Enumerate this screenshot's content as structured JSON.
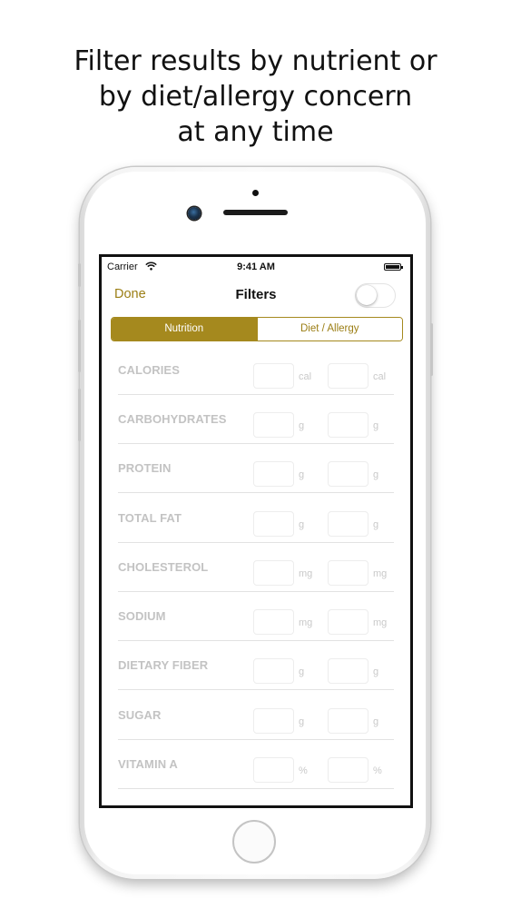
{
  "headline": {
    "line1": "Filter results by nutrient or",
    "line2": "by diet/allergy concern",
    "line3": "at any time"
  },
  "status_bar": {
    "carrier": "Carrier",
    "time": "9:41 AM"
  },
  "nav": {
    "done_label": "Done",
    "title": "Filters",
    "toggle_on": false
  },
  "segments": {
    "nutrition": "Nutrition",
    "diet_allergy": "Diet / Allergy",
    "selected": "Nutrition"
  },
  "nutrients": [
    {
      "label": "CALORIES",
      "unit": "cal"
    },
    {
      "label": "CARBOHYDRATES",
      "unit": "g"
    },
    {
      "label": "PROTEIN",
      "unit": "g"
    },
    {
      "label": "TOTAL FAT",
      "unit": "g"
    },
    {
      "label": "CHOLESTEROL",
      "unit": "mg"
    },
    {
      "label": "SODIUM",
      "unit": "mg"
    },
    {
      "label": "DIETARY FIBER",
      "unit": "g"
    },
    {
      "label": "SUGAR",
      "unit": "g"
    },
    {
      "label": "VITAMIN A",
      "unit": "%"
    }
  ],
  "colors": {
    "accent": "#a5891e",
    "label_gray": "#c3c3c3"
  }
}
